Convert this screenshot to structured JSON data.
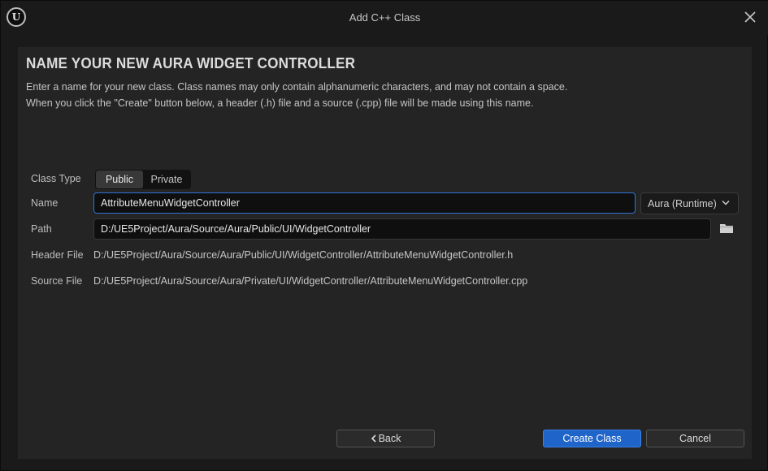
{
  "window": {
    "title": "Add C++ Class",
    "logo_icon": "unreal-engine-logo",
    "logo_text": "U"
  },
  "header": {
    "title": "NAME YOUR NEW AURA WIDGET CONTROLLER",
    "description_line1": "Enter a name for your new class. Class names may only contain alphanumeric characters, and may not contain a space.",
    "description_line2": "When you click the \"Create\" button below, a header (.h) file and a source (.cpp) file will be made using this name."
  },
  "form": {
    "class_type_label": "Class Type",
    "class_type_options": [
      "Public",
      "Private"
    ],
    "class_type_selected": "Public",
    "name_label": "Name",
    "name_value": "AttributeMenuWidgetController",
    "module_dropdown": "Aura (Runtime)",
    "path_label": "Path",
    "path_value": "D:/UE5Project/Aura/Source/Aura/Public/UI/WidgetController",
    "header_file_label": "Header File",
    "header_file_value": "D:/UE5Project/Aura/Source/Aura/Public/UI/WidgetController/AttributeMenuWidgetController.h",
    "source_file_label": "Source File",
    "source_file_value": "D:/UE5Project/Aura/Source/Aura/Private/UI/WidgetController/AttributeMenuWidgetController.cpp"
  },
  "footer": {
    "back_label": "Back",
    "create_label": "Create Class",
    "cancel_label": "Cancel"
  },
  "colors": {
    "accent": "#1f64c9",
    "focus_border": "#2f75d6",
    "panel_bg": "#242424",
    "window_bg": "#1a1a1a"
  }
}
